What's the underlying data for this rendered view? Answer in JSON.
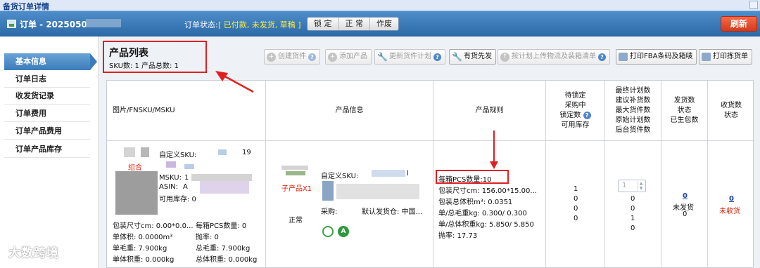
{
  "window": {
    "title": "备货订单详情"
  },
  "order": {
    "id_prefix": "订单 - 2025050",
    "status_label": "订单状态:",
    "status_value": "[ 已付款, 未发货, 草稿 ]",
    "actions": [
      "锁 定",
      "正 常",
      "作废"
    ],
    "refresh_label": "刷新"
  },
  "sidebar": {
    "items": [
      {
        "label": "基本信息",
        "active": true
      },
      {
        "label": "订单日志"
      },
      {
        "label": "收发货记录"
      },
      {
        "label": "订单费用"
      },
      {
        "label": "订单产品费用"
      },
      {
        "label": "订单产品库存"
      }
    ]
  },
  "product_list": {
    "title": "产品列表",
    "summary": "SKU数: 1 产品总数: 1"
  },
  "toolbar": {
    "create_shipment": "创建货件",
    "add_product": "添加产品",
    "update_plan": "更新货件计划",
    "stock_first": "有货先发",
    "upload_plan": "按计划上传物流及装箱清单",
    "print_fba": "打印FBA条码及箱唛",
    "print_pick": "打印拣货单"
  },
  "table": {
    "headers": {
      "image": "图片/FNSKU/MSKU",
      "info": "产品信息",
      "spec": "产品规则",
      "lock": [
        "待锁定",
        "采购中",
        "锁定数",
        "可用库存"
      ],
      "plan": [
        "最终计划数",
        "建议补货数",
        "最大货件数",
        "原始计划数",
        "后台货件数"
      ],
      "ship": [
        "发货数",
        "状态",
        "已生包数"
      ],
      "recv": [
        "收货数",
        "状态"
      ]
    },
    "row": {
      "custom_sku_label": "自定义SKU:",
      "custom_sku_tail": "19",
      "combo_tag": "组合",
      "msku_label": "MSKU:",
      "msku_partial": "1",
      "asin_label": "ASIN:",
      "asin_partial": "A",
      "available_stock": "可用库存: 0",
      "pkg_size": "包装尺寸cm: 0.00*0.0...",
      "pcs_per_box_left": "每箱PCS数量: 0",
      "unit_volume": "单体积: 0.0000m³",
      "pull_rate": "抛率: 0",
      "unit_gross": "单毛重: 7.900kg",
      "total_gross": "总毛重: 7.900kg",
      "unit_vol_weight": "单体积重: 0.000kg",
      "total_vol_weight": "总体积重: 0.000kg",
      "child_tag": "子产品X1",
      "info_custom_sku_label": "自定义SKU:",
      "info_sku_tail": "l",
      "info_status": "正常",
      "purchase_label": "采购:",
      "warehouse": "默认发货仓: 中国...",
      "spec_pcs": "每箱PCS数量:10",
      "spec_size": "包装尺寸cm: 156.00*15.00...",
      "spec_volume": "包装总体积m³: 0.0351",
      "spec_gross": "单/总毛重kg: 0.300/ 0.300",
      "spec_volw": "单/总体积重kg: 5.850/ 5.850",
      "spec_rate": "抛率: 17.73",
      "lock_vals": [
        "1",
        "0",
        "0",
        "0"
      ],
      "spin_value": "1",
      "plan_vals": [
        "0",
        "0",
        "1",
        "0"
      ],
      "ship_count": "0",
      "ship_status": "未发货",
      "ship_packs": "0",
      "recv_count": "0",
      "recv_status": "未收货"
    }
  },
  "watermark": "大数跨境"
}
